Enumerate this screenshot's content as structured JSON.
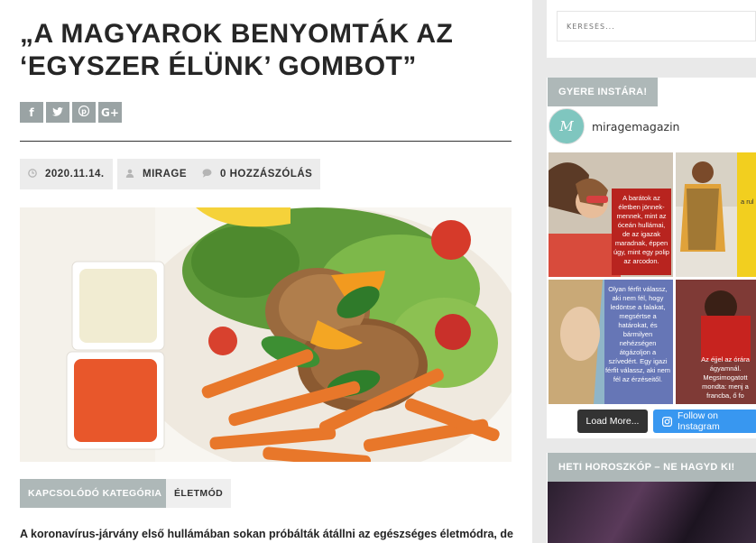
{
  "article": {
    "title": "„A magyarok benyomták az ‘egyszer élünk’ gombot”",
    "share": [
      {
        "icon": "facebook-icon",
        "glyph": "f"
      },
      {
        "icon": "twitter-icon",
        "glyph": "t"
      },
      {
        "icon": "pinterest-icon",
        "glyph": "p"
      },
      {
        "icon": "google-plus-icon",
        "glyph": "G+"
      }
    ],
    "meta": {
      "date": "2020.11.14.",
      "author": "MIRAGE",
      "comments": "0 HOZZÁSZÓLÁS"
    },
    "tags": {
      "category_label": "KAPCSOLÓDÓ KATEGÓRIA",
      "category": "ÉLETMÓD"
    },
    "body_first_line": "A koronavírus-járvány első hullámában sokan próbálták átállni az egészséges életmódra, de"
  },
  "sidebar": {
    "search_placeholder": "KERESÉS...",
    "instagram": {
      "widget_title": "GYERE INSTÁRA!",
      "avatar_letter": "M",
      "username": "miragemagazin",
      "quote1": "A barátok az életben jönnek-mennek, mint az óceán hullámai, de az igazak maradnak, éppen úgy, mint egy polip az arcodon.",
      "quote2": "Olyan férfit válassz, aki nem fél, hogy ledöntse a falakat, megsértse a határokat, és bármilyen nehézségen átgázoljon a szívedért. Egy igazi férfit válassz, aki nem fél az érzéseitől.",
      "quote3": "Az éjjel az órára ágyamnál. Megsimogatott mondta: menj a francba, ő fo",
      "partial_text": "a rul",
      "load_more": "Load More...",
      "follow": "Follow on Instagram"
    },
    "horoscope_title": "HETI HOROSZKÓP – NE HAGYD KI!"
  },
  "colors": {
    "accent_gray": "#aeb8b8",
    "share_gray": "#9aa3a4",
    "instagram_blue": "#3897f0",
    "load_more_dark": "#333333"
  }
}
